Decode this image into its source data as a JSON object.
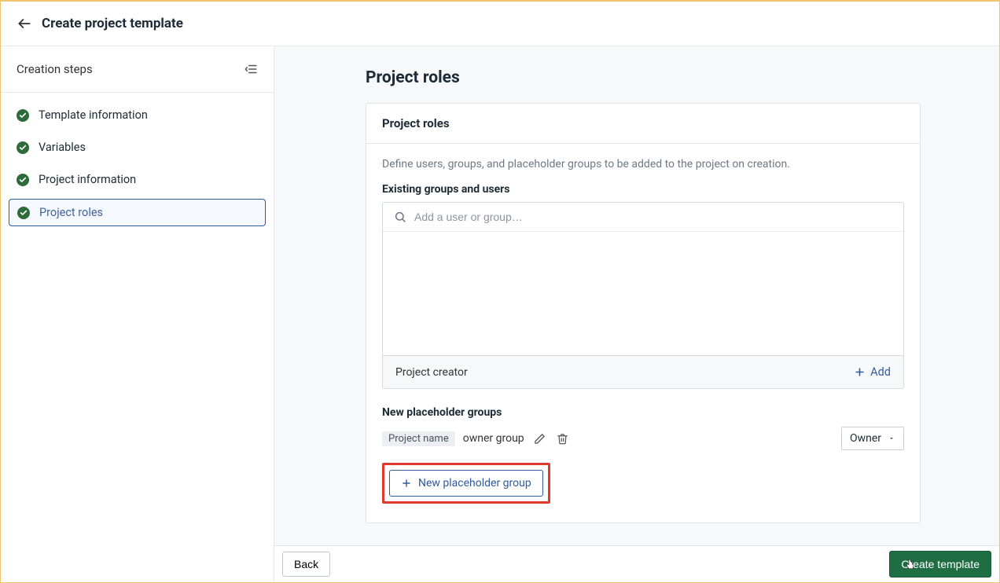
{
  "header": {
    "title": "Create project template"
  },
  "sidebar": {
    "title": "Creation steps",
    "steps": [
      {
        "label": "Template information"
      },
      {
        "label": "Variables"
      },
      {
        "label": "Project information"
      },
      {
        "label": "Project roles"
      }
    ]
  },
  "main": {
    "heading": "Project roles",
    "card_title": "Project roles",
    "description": "Define users, groups, and placeholder groups to be added to the project on creation.",
    "existing_label": "Existing groups and users",
    "search_placeholder": "Add a user or group…",
    "creator_label": "Project creator",
    "add_label": "Add",
    "placeholder_section_label": "New placeholder groups",
    "placeholder_tag": "Project name",
    "placeholder_group_name": "owner group",
    "role_select_value": "Owner",
    "new_placeholder_button": "New placeholder group"
  },
  "footer": {
    "back": "Back",
    "create": "Create template"
  }
}
